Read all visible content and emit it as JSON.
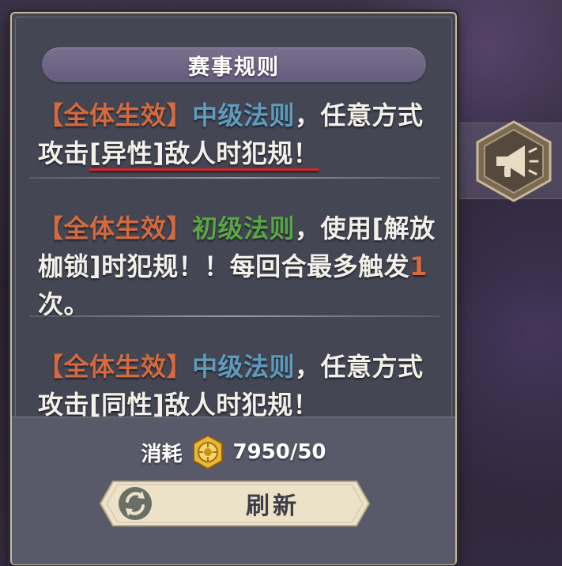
{
  "panel": {
    "title": "赛事规则"
  },
  "rules": [
    {
      "tag": "【全体生效】",
      "level": "中级法则",
      "after_level": "，任意方式攻击",
      "underlined": "[异性]敌人时犯规！",
      "level_color": "#5e9bbd"
    },
    {
      "tag": "【全体生效】",
      "level": "初级法则",
      "after_level": "，使用[解放枷锁]时犯规！！每回合最多触发",
      "count": "1",
      "tail": "次。",
      "level_color": "#58a646"
    },
    {
      "tag": "【全体生效】",
      "level": "中级法则",
      "after_level": "，任意方式攻击",
      "underlined": "[同性]敌人时犯规！",
      "level_color": "#5e9bbd"
    }
  ],
  "footer": {
    "cost_label": "消耗",
    "cost_value": "7950/50",
    "refresh_label": "刷新"
  },
  "icons": {
    "coin": "gold-coin-icon",
    "refresh": "refresh-arrows-icon",
    "announce": "megaphone-icon",
    "lock": "lock-icon"
  },
  "colors": {
    "tag": "#d56a3f",
    "mid_level": "#5e9bbd",
    "low_level": "#58a646",
    "underline": "#d9242a"
  }
}
